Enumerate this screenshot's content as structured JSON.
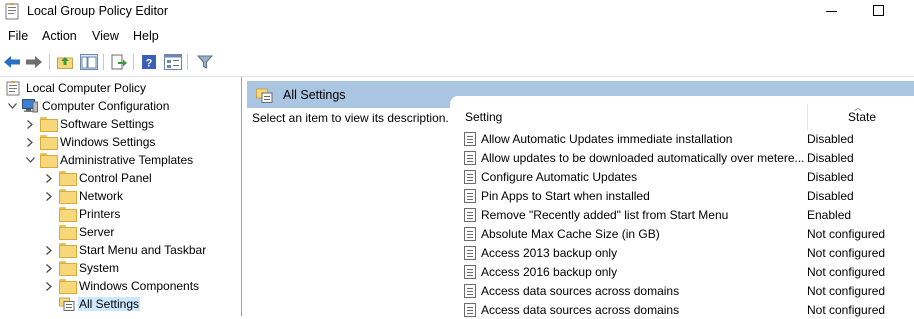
{
  "window": {
    "title": "Local Group Policy Editor"
  },
  "menu": [
    "File",
    "Action",
    "View",
    "Help"
  ],
  "toolbar": [
    "back-arrow-icon",
    "forward-arrow-icon",
    "up-folder-icon",
    "show-hide-tree-icon",
    "export-list-icon",
    "help-icon",
    "properties-icon",
    "filter-icon"
  ],
  "tree": [
    {
      "label": "Local Computer Policy",
      "indent": 0,
      "expander": "",
      "icon": "policy-root-icon"
    },
    {
      "label": "Computer Configuration",
      "indent": 1,
      "expander": "down",
      "icon": "computer-icon"
    },
    {
      "label": "Software Settings",
      "indent": 2,
      "expander": "right",
      "icon": "folder-icon"
    },
    {
      "label": "Windows Settings",
      "indent": 2,
      "expander": "right",
      "icon": "folder-icon"
    },
    {
      "label": "Administrative Templates",
      "indent": 2,
      "expander": "down",
      "icon": "folder-icon"
    },
    {
      "label": "Control Panel",
      "indent": 3,
      "expander": "right",
      "icon": "folder-icon"
    },
    {
      "label": "Network",
      "indent": 3,
      "expander": "right",
      "icon": "folder-icon"
    },
    {
      "label": "Printers",
      "indent": 3,
      "expander": "",
      "icon": "folder-icon"
    },
    {
      "label": "Server",
      "indent": 3,
      "expander": "",
      "icon": "folder-icon"
    },
    {
      "label": "Start Menu and Taskbar",
      "indent": 3,
      "expander": "right",
      "icon": "folder-icon"
    },
    {
      "label": "System",
      "indent": 3,
      "expander": "right",
      "icon": "folder-icon"
    },
    {
      "label": "Windows Components",
      "indent": 3,
      "expander": "right",
      "icon": "folder-icon"
    },
    {
      "label": "All Settings",
      "indent": 3,
      "expander": "",
      "icon": "all-settings-icon",
      "selected": true
    }
  ],
  "content": {
    "header": "All Settings",
    "description": "Select an item to view its description.",
    "columns": {
      "setting": "Setting",
      "state": "State"
    },
    "rows": [
      {
        "name": "Allow Automatic Updates immediate installation",
        "state": "Disabled"
      },
      {
        "name": "Allow updates to be downloaded automatically over metere...",
        "state": "Disabled"
      },
      {
        "name": "Configure Automatic Updates",
        "state": "Disabled"
      },
      {
        "name": "Pin Apps to Start when installed",
        "state": "Disabled"
      },
      {
        "name": "Remove \"Recently added\" list from Start Menu",
        "state": "Enabled"
      },
      {
        "name": "Absolute Max Cache Size (in GB)",
        "state": "Not configured"
      },
      {
        "name": "Access 2013 backup only",
        "state": "Not configured"
      },
      {
        "name": "Access 2016 backup only",
        "state": "Not configured"
      },
      {
        "name": "Access data sources across domains",
        "state": "Not configured"
      },
      {
        "name": "Access data sources across domains",
        "state": "Not configured"
      }
    ]
  },
  "colors": {
    "header_bg": "#a9c5e1",
    "selection_bg": "#cce8ff",
    "pane_bg": "#ffffff"
  }
}
